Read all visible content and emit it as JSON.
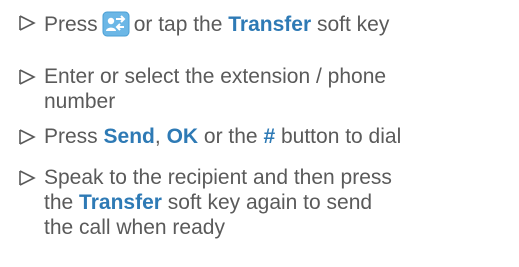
{
  "colors": {
    "text": "#5a5a5a",
    "keyword": "#2e7ab5",
    "icon_bg": "#6cb7e6",
    "icon_fg": "#ffffff"
  },
  "icons": {
    "bullet": "arrowhead-bullet-icon",
    "transfer": "transfer-key-icon"
  },
  "steps": [
    {
      "parts": [
        "Press",
        "or tap the",
        "Transfer",
        "soft key"
      ]
    },
    {
      "lines": [
        "Enter or select the extension / phone",
        "number"
      ]
    },
    {
      "parts": [
        "Press",
        "Send",
        ",",
        "OK",
        "or the",
        "#",
        "button to dial"
      ]
    },
    {
      "line1": "Speak to the recipient and then press",
      "line2_pre": "the",
      "line2_kw": "Transfer",
      "line2_post": "soft key again to send",
      "line3": "the call when ready"
    }
  ]
}
